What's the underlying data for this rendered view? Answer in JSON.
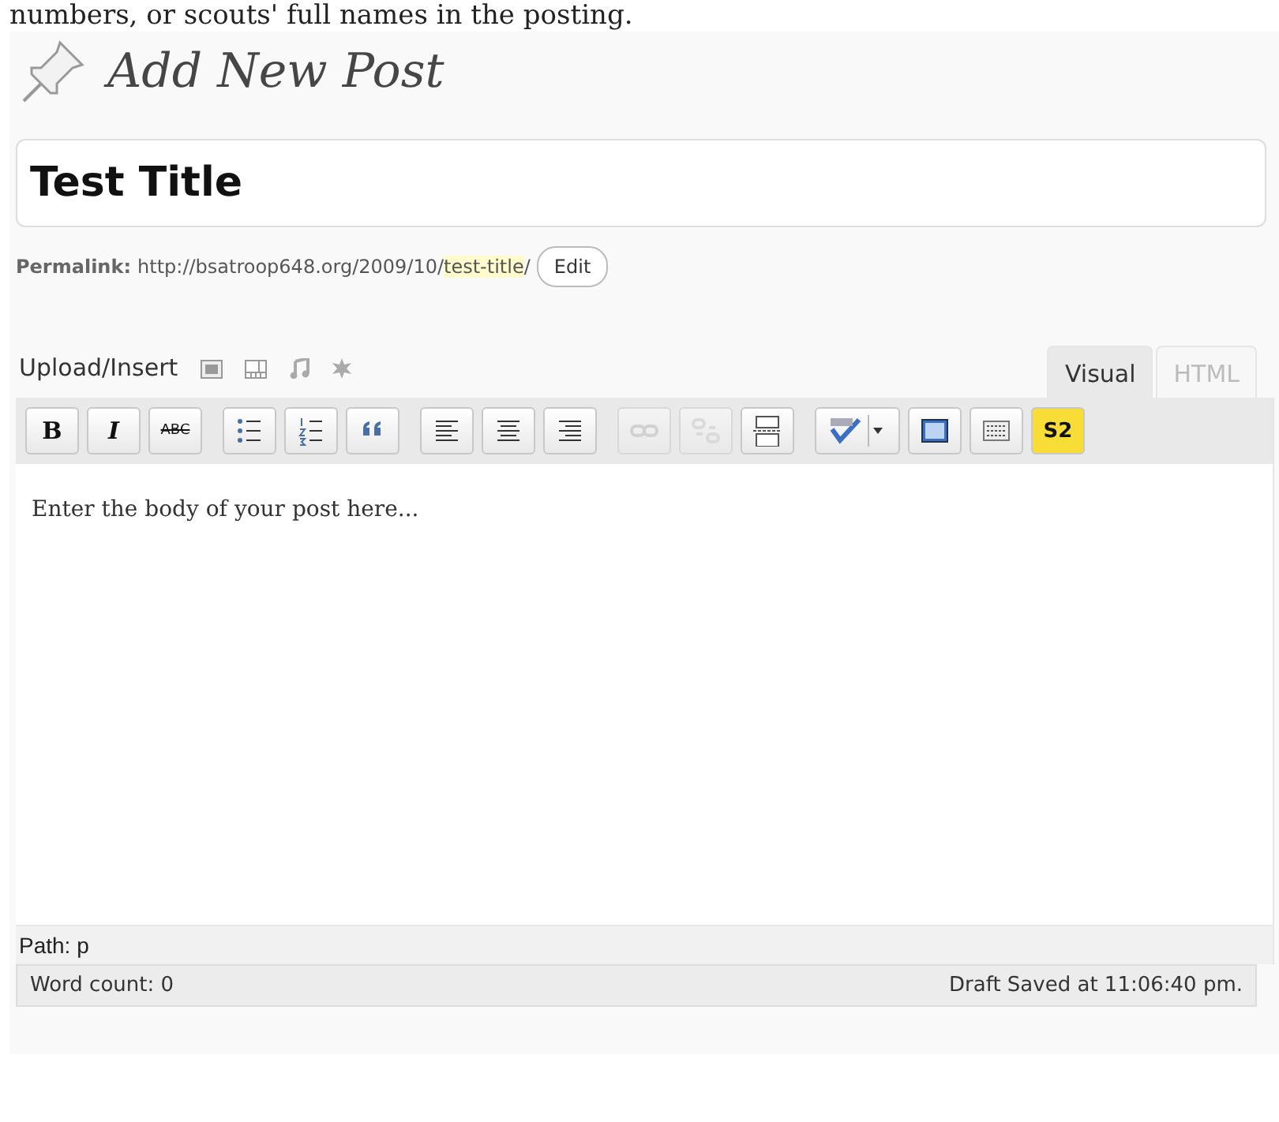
{
  "intro_text": "numbers, or scouts' full names in the posting.",
  "page_title": "Add New Post",
  "title_field": {
    "value": "Test Title"
  },
  "permalink": {
    "label": "Permalink:",
    "base": "http://bsatroop648.org/2009/10/",
    "slug": "test-title",
    "trail": "/",
    "button": "Edit"
  },
  "media": {
    "label": "Upload/Insert"
  },
  "tabs": [
    {
      "label": "Visual",
      "selected": true
    },
    {
      "label": "HTML",
      "selected": false
    }
  ],
  "toolbar": [
    {
      "kind": "bold",
      "label": "B",
      "disabled": false
    },
    {
      "kind": "italic",
      "label": "I",
      "disabled": false
    },
    {
      "kind": "strike",
      "label": "ABC",
      "disabled": false
    },
    {
      "kind": "bullets",
      "disabled": false
    },
    {
      "kind": "numbers",
      "disabled": false
    },
    {
      "kind": "quote",
      "disabled": false
    },
    {
      "kind": "align-left",
      "disabled": false
    },
    {
      "kind": "align-center",
      "disabled": false
    },
    {
      "kind": "align-right",
      "disabled": false
    },
    {
      "kind": "link",
      "disabled": true
    },
    {
      "kind": "unlink",
      "disabled": true
    },
    {
      "kind": "more",
      "disabled": false
    },
    {
      "kind": "spell",
      "disabled": false
    },
    {
      "kind": "fullscreen",
      "disabled": false
    },
    {
      "kind": "sink",
      "disabled": false
    },
    {
      "kind": "plugin",
      "label": "S2",
      "disabled": false
    }
  ],
  "editor": {
    "placeholder": "Enter the body of your post here..."
  },
  "path": "Path: p",
  "status_bar": {
    "word_count": "Word count: 0",
    "saved": "Draft Saved at 11:06:40 pm."
  }
}
